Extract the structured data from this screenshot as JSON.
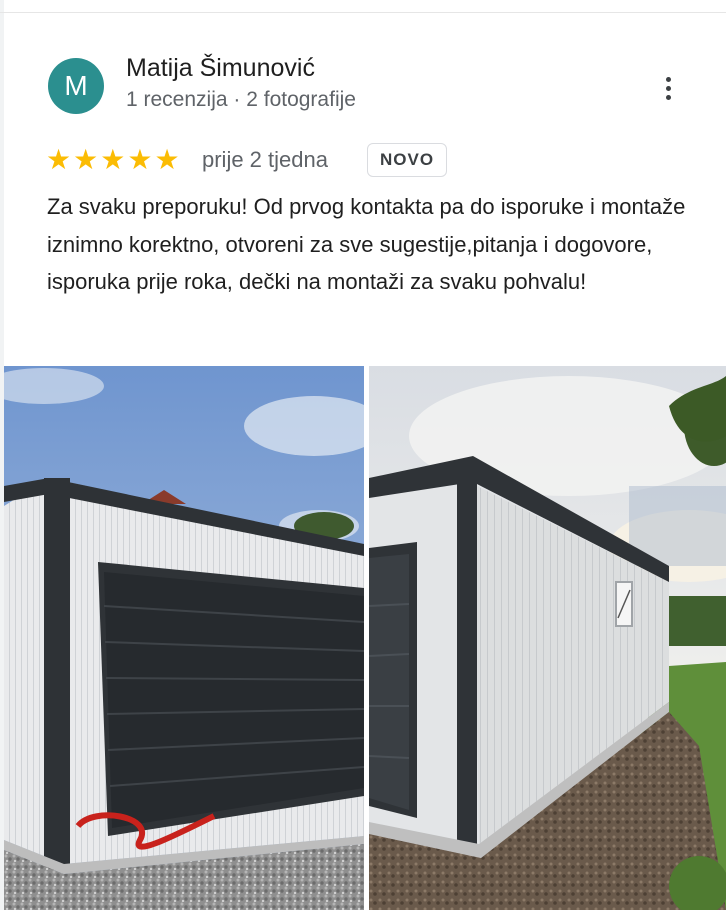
{
  "reviewer": {
    "initial": "M",
    "name": "Matija Šimunović",
    "meta": "1 recenzija · 2 fotografije"
  },
  "rating": {
    "stars": 5,
    "max_stars": 5,
    "time_ago": "prije 2 tjedna",
    "badge": "NOVO"
  },
  "review_text": "Za svaku preporuku! Od prvog kontakta pa do isporuke i montaže iznimno korektno, otvoreni za sve sugestije,pitanja i dogovore, isporuka prije roka, dečki na montaži za svaku pohvalu!",
  "photos": [
    {
      "name": "garage-front-photo"
    },
    {
      "name": "garage-side-photo"
    }
  ],
  "colors": {
    "avatar": "#2b8f8f",
    "star": "#fbbc04",
    "secondary_text": "#5f6368"
  },
  "icons": {
    "more": "more-vertical-icon",
    "star": "star-icon"
  }
}
